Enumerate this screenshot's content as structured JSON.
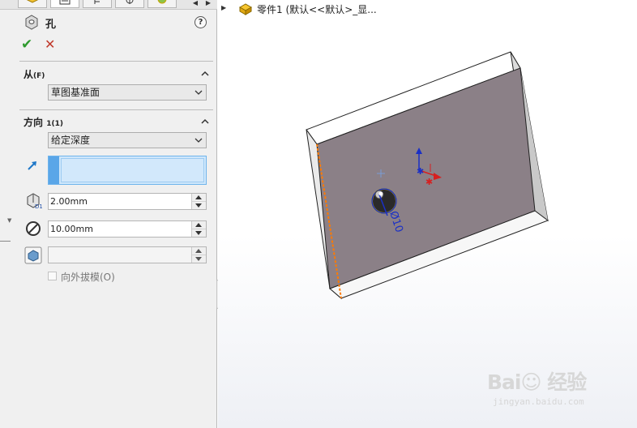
{
  "header": {
    "feature_title": "孔",
    "help_label": "?"
  },
  "actions": {
    "ok_glyph": "✔",
    "cancel_glyph": "✕"
  },
  "from_section": {
    "title": "从",
    "shortcut": "(F)",
    "selected": "草图基准面"
  },
  "direction_section": {
    "title": "方向",
    "index": "1(1)",
    "end_condition": "给定深度",
    "depth_value": "2.00mm",
    "diameter_value": "10.00mm",
    "draft_value": "",
    "draft_outward_label": "向外拔模(O)"
  },
  "graphics": {
    "tree_text": "零件1  (默认<<默认>_显..."
  },
  "sketch": {
    "diameter_label": "Ø10"
  },
  "watermark": {
    "logo": "Bai☺ 经验",
    "sub": "jingyan.baidu.com"
  },
  "colors": {
    "face": "#8b8087",
    "accent_blue": "#5aa6e8",
    "axis_x": "#d62020",
    "axis_y": "#1a2fc6",
    "edge_highlight": "#ff7a00"
  }
}
